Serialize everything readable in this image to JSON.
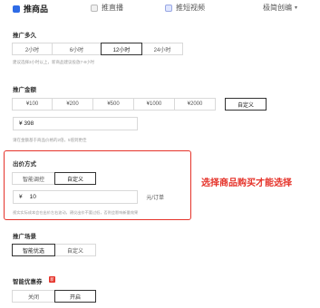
{
  "tabs": [
    {
      "label": "推商品"
    },
    {
      "label": "推直播"
    },
    {
      "label": "推短视频"
    }
  ],
  "top_right_menu": {
    "label": "极简创编"
  },
  "duration": {
    "title": "推广多久",
    "options": [
      "2小时",
      "6小时",
      "12小时",
      "24小时"
    ],
    "selected_index": 2,
    "hint": "建议选择3小时以上，新商品建议投放7-8小时"
  },
  "budget": {
    "title": "推广金额",
    "options": [
      "¥100",
      "¥200",
      "¥500",
      "¥1000",
      "¥2000",
      "自定义"
    ],
    "selected_index": 5,
    "input_value": "¥ 398",
    "hint": "请在金额基于商品价格的2倍，5倍到更佳"
  },
  "bid": {
    "title": "出价方式",
    "options": [
      "智能调控",
      "自定义"
    ],
    "selected_index": 1,
    "prefix": "¥",
    "input_value": "10",
    "unit": "元/订单",
    "hint": "视实实际成本会在出价左右波动，建议出价不要过低，否则会影响新量效果"
  },
  "strategy": {
    "title": "推广场景",
    "options": [
      "智能优选",
      "自定义"
    ],
    "selected_index": 0
  },
  "coupon": {
    "title": "智能优惠券",
    "badge": "新",
    "options": [
      "关闭",
      "开启"
    ],
    "selected_index": 1
  },
  "annotation": {
    "text": "选择商品购买才能选择"
  },
  "colors": {
    "accent": "#2e6be6",
    "annotation_red": "#e5332a"
  }
}
